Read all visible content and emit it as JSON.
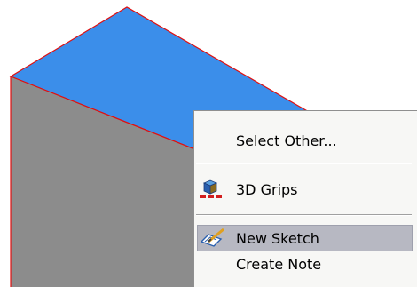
{
  "viewport": {
    "top_face_color": "#3b8eea",
    "side_face_color": "#8c8c8c",
    "edge_color": "#e01010"
  },
  "context_menu": {
    "items": [
      {
        "label_before": "Select ",
        "label_underlined": "O",
        "label_after": "ther...",
        "icon": null
      },
      {
        "label": "3D Grips",
        "icon": "3d-grips-icon"
      },
      {
        "label": "New Sketch",
        "icon": "new-sketch-icon",
        "highlighted": true
      },
      {
        "label": "Create Note",
        "icon": null
      }
    ]
  }
}
